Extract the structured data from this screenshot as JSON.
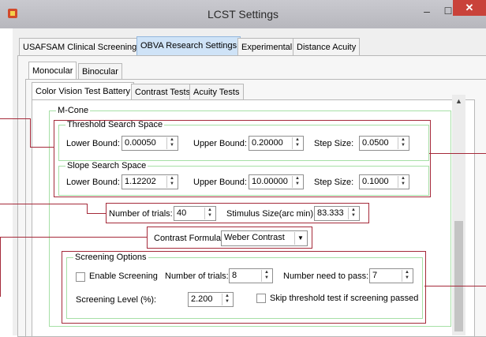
{
  "window": {
    "title": "LCST Settings",
    "minimize": "–",
    "maximize": "☐",
    "close": "✕"
  },
  "tabs_main": [
    {
      "label": "USAFSAM Clinical Screening",
      "active": false
    },
    {
      "label": "OBVA Research Settings",
      "active": true
    },
    {
      "label": "Experimental",
      "active": false
    },
    {
      "label": "Distance Acuity",
      "active": false
    }
  ],
  "tabs_eye": [
    {
      "label": "Monocular",
      "active": true
    },
    {
      "label": "Binocular",
      "active": false
    }
  ],
  "tabs_test": [
    {
      "label": "Color Vision Test Battery",
      "active": true
    },
    {
      "label": "Contrast Tests",
      "active": false
    },
    {
      "label": "Acuity Tests",
      "active": false
    }
  ],
  "mcone": {
    "title": "M-Cone",
    "threshold": {
      "title": "Threshold Search Space",
      "lower_label": "Lower Bound:",
      "lower_value": "0.00050",
      "upper_label": "Upper Bound:",
      "upper_value": "0.20000",
      "step_label": "Step Size:",
      "step_value": "0.0500"
    },
    "slope": {
      "title": "Slope Search Space",
      "lower_label": "Lower Bound:",
      "lower_value": "1.12202",
      "upper_label": "Upper Bound:",
      "upper_value": "10.00000",
      "step_label": "Step Size:",
      "step_value": "0.1000"
    },
    "trials_label": "Number of trials:",
    "trials_value": "40",
    "stimulus_label": "Stimulus Size(arc min):",
    "stimulus_value": "83.333",
    "formula_label": "Contrast Formula",
    "formula_value": "Weber Contrast",
    "screening": {
      "title": "Screening Options",
      "enable_label": "Enable Screening",
      "enable_checked": false,
      "trials_label": "Number of trials:",
      "trials_value": "8",
      "need_label": "Number need to pass:",
      "need_value": "7",
      "level_label": "Screening Level (%):",
      "level_value": "2.200",
      "skip_label": "Skip threshold test if screening passed",
      "skip_checked": false
    }
  },
  "colors": {
    "annotation": "#a52a3a",
    "group_border": "#a6e0a6",
    "active_tab": "#cfe3f7"
  }
}
